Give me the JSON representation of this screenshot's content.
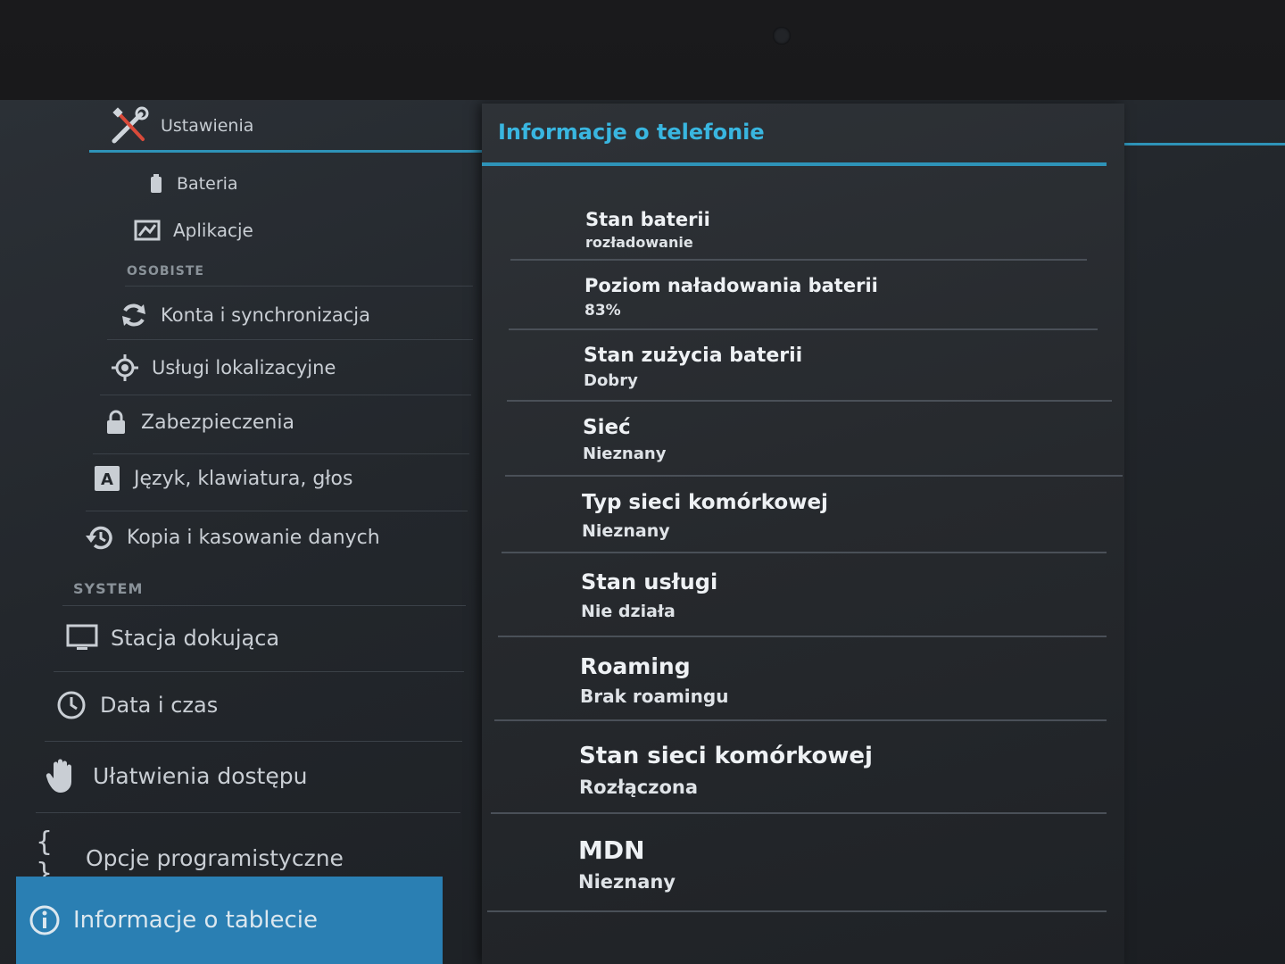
{
  "app": {
    "title": "Ustawienia"
  },
  "sidebar": {
    "items": [
      {
        "label": "Bateria",
        "icon": "battery-icon"
      },
      {
        "label": "Aplikacje",
        "icon": "apps-icon"
      },
      {
        "label": "Konta i synchronizacja",
        "icon": "sync-icon"
      },
      {
        "label": "Usługi lokalizacyjne",
        "icon": "location-icon"
      },
      {
        "label": "Zabezpieczenia",
        "icon": "lock-icon"
      },
      {
        "label": "Język, klawiatura, głos",
        "icon": "keyboard-icon"
      },
      {
        "label": "Kopia i kasowanie danych",
        "icon": "backup-icon"
      },
      {
        "label": "Stacja dokująca",
        "icon": "monitor-icon"
      },
      {
        "label": "Data i czas",
        "icon": "clock-icon"
      },
      {
        "label": "Ułatwienia dostępu",
        "icon": "hand-icon"
      },
      {
        "label": "Opcje programistyczne",
        "icon": "braces-icon"
      },
      {
        "label": "Informacje o tablecie",
        "icon": "info-icon"
      }
    ],
    "headers": {
      "personal": "OSOBISTE",
      "system": "SYSTEM"
    }
  },
  "panel": {
    "title": "Informacje o telefonie",
    "rows": [
      {
        "label": "Stan baterii",
        "value": "rozładowanie"
      },
      {
        "label": "Poziom naładowania baterii",
        "value": "83%"
      },
      {
        "label": "Stan zużycia baterii",
        "value": "Dobry"
      },
      {
        "label": "Sieć",
        "value": "Nieznany"
      },
      {
        "label": "Typ sieci komórkowej",
        "value": "Nieznany"
      },
      {
        "label": "Stan usługi",
        "value": "Nie działa"
      },
      {
        "label": "Roaming",
        "value": "Brak roamingu"
      },
      {
        "label": "Stan sieci komórkowej",
        "value": "Rozłączona"
      },
      {
        "label": "MDN",
        "value": "Nieznany"
      }
    ]
  },
  "colors": {
    "accent": "#2e93b8",
    "title": "#39b6e0",
    "active": "#2a7fb3"
  }
}
